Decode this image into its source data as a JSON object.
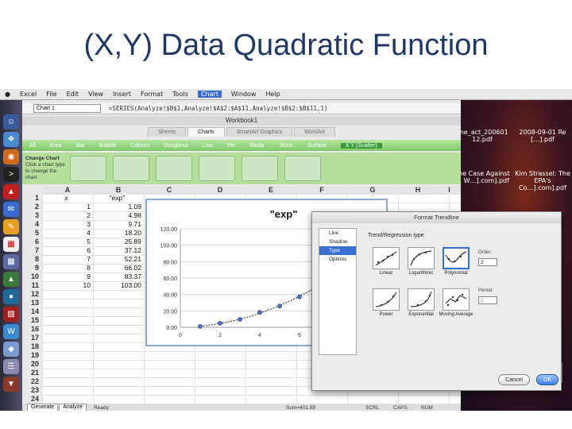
{
  "slide_title": "(X,Y) Data Quadratic Function",
  "menubar": {
    "items": [
      "Excel",
      "File",
      "Edit",
      "View",
      "Insert",
      "Format",
      "Tools",
      "Chart",
      "Window",
      "Help"
    ],
    "active": "Chart"
  },
  "formula_bar": {
    "name_box": "Chart 1",
    "formula": "=SERIES(Analyze!$B$1,Analyze!$A$2:$A$11,Analyze!$B$2:$B$11,1)"
  },
  "workbook_title": "Workbook1",
  "ribbon_tabs": [
    "Sheets",
    "Charts",
    "SmartArt Graphics",
    "WordArt"
  ],
  "ribbon_active": "Charts",
  "chart_types": [
    "All",
    "Area",
    "Bar",
    "Bubble",
    "Column",
    "Doughnut",
    "Line",
    "Pie",
    "Radar",
    "Stock",
    "Surface",
    "X Y (Scatter)"
  ],
  "chart_type_selected": "X Y (Scatter)",
  "change_chart": "Change Chart",
  "change_chart_hint": "Click a chart type to change the chart.",
  "columns": [
    "A",
    "B",
    "C",
    "D",
    "E",
    "F",
    "G",
    "H",
    "I"
  ],
  "header_row": {
    "a": "x",
    "b": "\"exp\""
  },
  "rows": [
    {
      "x": "1",
      "y": "1.09"
    },
    {
      "x": "2",
      "y": "4.98"
    },
    {
      "x": "3",
      "y": "9.71"
    },
    {
      "x": "4",
      "y": "18.20"
    },
    {
      "x": "5",
      "y": "25.89"
    },
    {
      "x": "6",
      "y": "37.12"
    },
    {
      "x": "7",
      "y": "52.21"
    },
    {
      "x": "8",
      "y": "66.02"
    },
    {
      "x": "9",
      "y": "83.37"
    },
    {
      "x": "10",
      "y": "103.00"
    }
  ],
  "row_numbers": [
    "1",
    "2",
    "3",
    "4",
    "5",
    "6",
    "7",
    "8",
    "9",
    "10",
    "11",
    "12",
    "13",
    "14",
    "15",
    "16",
    "17",
    "18",
    "19",
    "20",
    "21",
    "22",
    "23",
    "24"
  ],
  "sheet_tabs": [
    "Generate",
    "Analyze"
  ],
  "status": {
    "mode": "Ready",
    "sum": "Sum=401.59",
    "scrl": "SCRL",
    "caps": "CAPS",
    "num": "NUM"
  },
  "chart_data": {
    "type": "scatter",
    "title": "\"exp\"",
    "x": [
      1,
      2,
      3,
      4,
      5,
      6,
      7,
      8,
      9,
      10
    ],
    "series": [
      {
        "values": [
          1.09,
          4.98,
          9.71,
          18.2,
          25.89,
          37.12,
          52.21,
          66.02,
          83.37,
          103.0
        ]
      }
    ],
    "xlim": [
      0,
      10
    ],
    "ylim": [
      0,
      120
    ],
    "x_ticks": [
      "0",
      "2",
      "4",
      "6",
      "8",
      "10"
    ],
    "y_ticks": [
      "0.00",
      "20.00",
      "40.00",
      "60.00",
      "80.00",
      "100.00",
      "120.00"
    ],
    "grid": true,
    "marker_color": "#4a72c0",
    "line_color": "#2a2a2a"
  },
  "dialog": {
    "title": "Format Trendline",
    "nav": [
      "Line",
      "Shadow",
      "Type",
      "Options"
    ],
    "nav_selected": "Type",
    "section": "Trend/Regression type",
    "types": [
      "Linear",
      "Logarithmic",
      "Polynomial",
      "Power",
      "Exponential",
      "Moving Average"
    ],
    "type_selected": "Polynomial",
    "order_label": "Order:",
    "order_value": "2",
    "period_label": "Period:",
    "period_value": "2",
    "cancel": "Cancel",
    "ok": "OK"
  },
  "desktop_files": [
    {
      "name": "line_act_200601 12.pdf"
    },
    {
      "name": "2008-09-01 Re […].pdf"
    },
    {
      "name": "The Case Against … W…].com].pdf"
    },
    {
      "name": "Kim Strassel: The EPA's Co…].com].pdf"
    }
  ]
}
